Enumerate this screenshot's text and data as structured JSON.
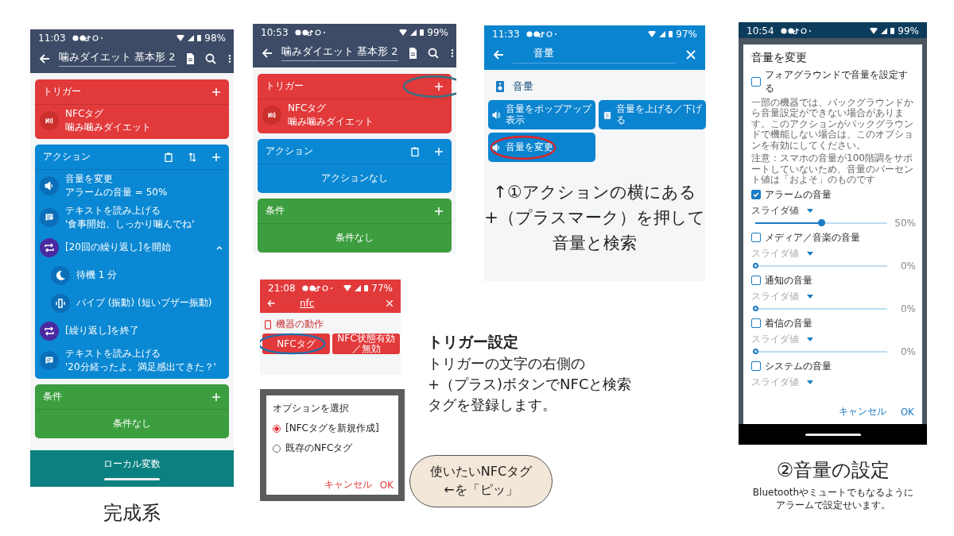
{
  "finished_screen": {
    "status": {
      "time": "11:03",
      "battery": "98%"
    },
    "title": "噛みダイエット 基本形 2",
    "trigger": {
      "title": "トリガー",
      "items": [
        {
          "title": "NFCタグ",
          "subtitle": "噛み噛みダイエット"
        }
      ]
    },
    "action": {
      "title": "アクション",
      "sort_button": true,
      "items": [
        {
          "kind": "volume",
          "title": "音量を変更",
          "subtitle": "アラームの音量 = 50%"
        },
        {
          "kind": "speak",
          "title": "テキストを読み上げる",
          "subtitle": "'食事開始、しっかり噛んでね'"
        },
        {
          "kind": "loop",
          "title": "[20回の繰り返し]を開始",
          "expanded": true,
          "children": [
            {
              "kind": "sleep",
              "title": "待機 1 分"
            },
            {
              "kind": "vibrate",
              "title": "バイブ (振動) (短いブザー振動)"
            }
          ]
        },
        {
          "kind": "loop",
          "title": "[繰り返し]を終了"
        },
        {
          "kind": "speak",
          "title": "テキストを読み上げる",
          "subtitle": "'20分経ったよ。満足感出てきた？'"
        }
      ]
    },
    "condition": {
      "title": "条件",
      "empty": "条件なし"
    },
    "bottom_tab": "ローカル変数",
    "caption": "完成系"
  },
  "start_screen": {
    "status": {
      "time": "10:53",
      "battery": "99%"
    },
    "title": "噛みダイエット 基本形 2",
    "trigger": {
      "title": "トリガー",
      "add_circled": true,
      "items": [
        {
          "title": "NFCタグ",
          "subtitle": "噛み噛みダイエット"
        }
      ]
    },
    "action": {
      "title": "アクション",
      "empty": "アクションなし"
    },
    "condition": {
      "title": "条件",
      "empty": "条件なし"
    }
  },
  "volume_search": {
    "status": {
      "time": "11:33",
      "battery": "97%"
    },
    "query": "音量",
    "section": "音量",
    "buttons": [
      {
        "kind": "popup",
        "label": "音量をポップアップ表示",
        "circled": false
      },
      {
        "kind": "updown",
        "label": "音量を上げる／下げる",
        "circled": false
      },
      {
        "kind": "volume",
        "label": "音量を変更",
        "circled": true
      }
    ],
    "caption": [
      "↑①アクションの横にある",
      "+（プラスマーク）を押して",
      "音量と検索"
    ]
  },
  "volume_dialog": {
    "status": {
      "time": "10:54",
      "battery": "99%"
    },
    "title": "音量を変更",
    "foreground": {
      "label": "フォアグラウンドで音量を設定する",
      "checked": false
    },
    "notes": [
      "一部の機器では、バックグラウンドから音量設定ができない場合があります。このアクションがバックグラウンドで機能しない場合は、このオプションを有効にしてください。",
      "注意：スマホの音量が100階調をサポートしていないため、音量のパーセント値は「およそ」のものです"
    ],
    "streams": [
      {
        "label": "アラームの音量",
        "checked": true,
        "mode": "スライダ値",
        "level": 0.5,
        "reading": "50%"
      },
      {
        "label": "メディア／音楽の音量",
        "checked": false,
        "mode": "スライダ値",
        "level": 0,
        "reading": "0%"
      },
      {
        "label": "通知の音量",
        "checked": false,
        "mode": "スライダ値",
        "level": 0,
        "reading": "0%"
      },
      {
        "label": "着信の音量",
        "checked": false,
        "mode": "スライダ値",
        "level": 0,
        "reading": "0%"
      },
      {
        "label": "システムの音量",
        "checked": false,
        "mode": "スライダ値"
      }
    ],
    "buttons": [
      "キャンセル",
      "OK"
    ],
    "caption": "②音量の設定",
    "note_lines": [
      "Bluetoothやミュートでもなるように",
      "アラームで設定せいます。"
    ]
  },
  "nfc_search": {
    "status": {
      "time": "21:08",
      "battery": "77%"
    },
    "query": "nfc",
    "section": "機器の動作",
    "buttons": [
      {
        "label": "NFCタグ",
        "circled": true
      },
      {
        "label": "NFC状態有効／無効",
        "circled": false
      }
    ]
  },
  "option_dialog": {
    "title": "オプションを選択",
    "options": [
      {
        "label": "[NFCタグを新規作成]",
        "selected": true
      },
      {
        "label": "既存のNFCタグ",
        "selected": false
      }
    ],
    "buttons": [
      "キャンセル",
      "OK"
    ]
  },
  "bubble": [
    "使いたいNFCタグ",
    "←を「ピッ」"
  ],
  "trigger_note": {
    "title": "トリガー設定",
    "lines": [
      "トリガーの文字の右側の",
      "+（プラス)ボタンでNFCと検索",
      "タグを登録します。"
    ]
  }
}
